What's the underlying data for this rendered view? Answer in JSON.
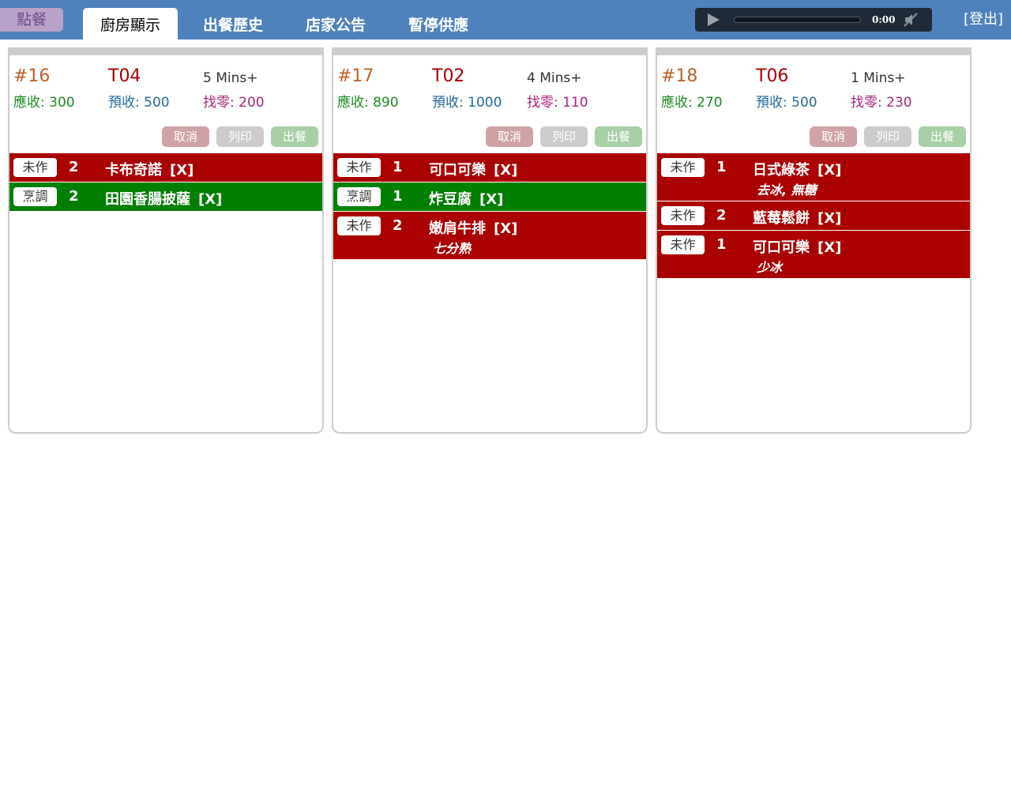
{
  "header": {
    "order_button": "點餐",
    "tabs": [
      "廚房顯示",
      "出餐歷史",
      "店家公告",
      "暫停供應"
    ],
    "active_tab": "廚房顯示",
    "logout": "[登出]",
    "player": {
      "time": "0:00",
      "play_icon": "play-icon",
      "mute_icon": "muted-speaker-icon"
    }
  },
  "colors": {
    "topbar": "#4f81bd",
    "item_pending": "#aa0000",
    "item_cooking": "#007f00",
    "order_number": "#c0602a",
    "table": "#aa0000",
    "due": "#1d8a24",
    "prepaid": "#236aa0",
    "change": "#a8247a"
  },
  "orders": [
    {
      "number": "#16",
      "table": "T04",
      "elapsed": "5 Mins+",
      "due": "應收: 300",
      "prepaid": "預收: 500",
      "change": "找零: 200",
      "actions": {
        "cancel": "取消",
        "print": "列印",
        "serve": "出餐"
      },
      "items": [
        {
          "status": "未作",
          "qty": "2",
          "name": "卡布奇諾",
          "remove": "[X]",
          "note": ""
        },
        {
          "status": "烹調",
          "qty": "2",
          "name": "田園香腸披薩",
          "remove": "[X]",
          "note": ""
        }
      ]
    },
    {
      "number": "#17",
      "table": "T02",
      "elapsed": "4 Mins+",
      "due": "應收: 890",
      "prepaid": "預收: 1000",
      "change": "找零: 110",
      "actions": {
        "cancel": "取消",
        "print": "列印",
        "serve": "出餐"
      },
      "items": [
        {
          "status": "未作",
          "qty": "1",
          "name": "可口可樂",
          "remove": "[X]",
          "note": ""
        },
        {
          "status": "烹調",
          "qty": "1",
          "name": "炸豆腐",
          "remove": "[X]",
          "note": ""
        },
        {
          "status": "未作",
          "qty": "2",
          "name": "嫩肩牛排",
          "remove": "[X]",
          "note": "七分熟"
        }
      ]
    },
    {
      "number": "#18",
      "table": "T06",
      "elapsed": "1 Mins+",
      "due": "應收: 270",
      "prepaid": "預收: 500",
      "change": "找零: 230",
      "actions": {
        "cancel": "取消",
        "print": "列印",
        "serve": "出餐"
      },
      "items": [
        {
          "status": "未作",
          "qty": "1",
          "name": "日式綠茶",
          "remove": "[X]",
          "note": "去冰, 無糖"
        },
        {
          "status": "未作",
          "qty": "2",
          "name": "藍莓鬆餅",
          "remove": "[X]",
          "note": ""
        },
        {
          "status": "未作",
          "qty": "1",
          "name": "可口可樂",
          "remove": "[X]",
          "note": "少冰"
        }
      ]
    }
  ]
}
